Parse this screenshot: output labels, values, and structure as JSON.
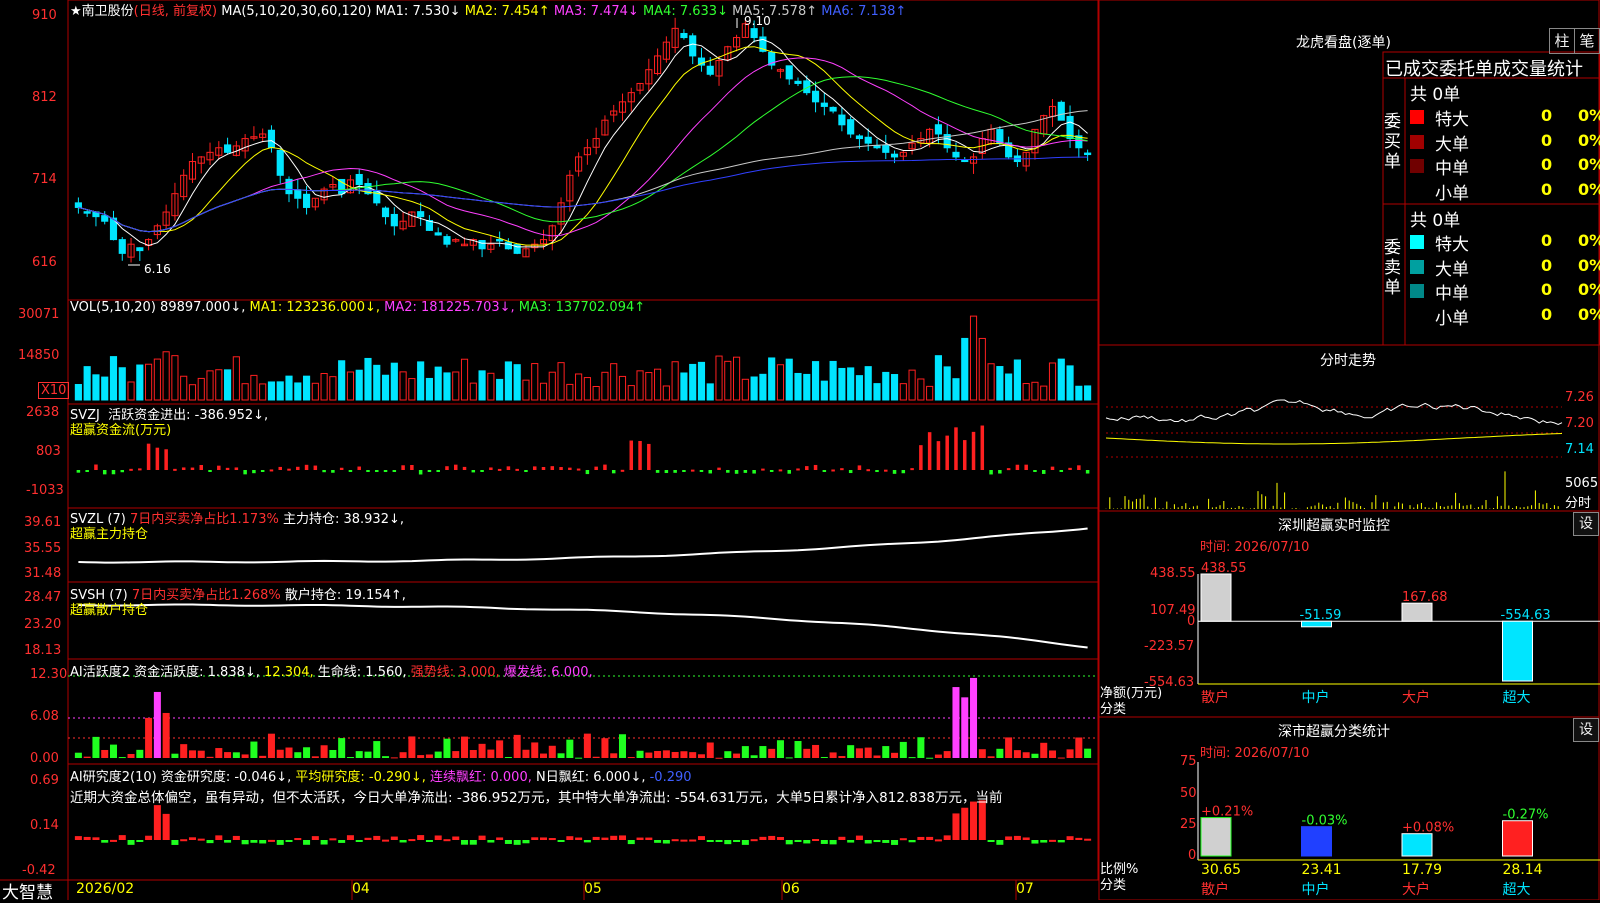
{
  "app": {
    "name": "大智慧"
  },
  "stock": {
    "name": "南卫股份",
    "period": "(日线, 前复权)"
  },
  "colors": {
    "up": "#ff2020",
    "down": "#00e5ff",
    "ma1": "#ffffff",
    "ma2": "#ffff00",
    "ma3": "#ff40ff",
    "ma4": "#30ff30",
    "ma5": "#c8c8c8",
    "ma6": "#3040ff"
  },
  "price_panel": {
    "ma_header": "MA(5,10,20,30,60,120)",
    "ma_items": [
      {
        "label": "MA1: 7.530↓",
        "color": "#ffffff"
      },
      {
        "label": "MA2: 7.454↑",
        "color": "#ffff00"
      },
      {
        "label": "MA3: 7.474↓",
        "color": "#ff40ff"
      },
      {
        "label": "MA4: 7.633↓",
        "color": "#30ff30"
      },
      {
        "label": "MA5: 7.578↑",
        "color": "#c8c8c8"
      },
      {
        "label": "MA6: 7.138↑",
        "color": "#4060ff"
      }
    ],
    "y_ticks": [
      "910",
      "812",
      "714",
      "616"
    ],
    "high_label": "9.10",
    "low_label": "6.16"
  },
  "vol_panel": {
    "header": "VOL(5,10,20)",
    "items": [
      {
        "label": "89897.000↓,",
        "color": "#ffffff"
      },
      {
        "label": "MA1: 123236.000↓,",
        "color": "#ffff00"
      },
      {
        "label": "MA2: 181225.703↓,",
        "color": "#ff40ff"
      },
      {
        "label": "MA3: 137702.094↑",
        "color": "#30ff30"
      }
    ],
    "y_ticks": [
      "30071",
      "14850"
    ],
    "unit": "X10"
  },
  "svzj_panel": {
    "header": "SVZJ",
    "item": "活跃资金进出: -386.952↓,",
    "subtitle": "超赢资金流(万元)",
    "y_ticks": [
      "2638",
      "803",
      "-1033"
    ]
  },
  "svzl_panel": {
    "header": "SVZL (7)",
    "pct": "7日内买卖净占比1.173%",
    "item": "主力持仓: 38.932↓,",
    "subtitle": "超赢主力持仓",
    "y_ticks": [
      "39.61",
      "35.55",
      "31.48"
    ]
  },
  "svsh_panel": {
    "header": "SVSH (7)",
    "pct": "7日内买卖净占比1.268%",
    "item": "散户持仓: 19.154↑,",
    "subtitle": "超赢散户持仓",
    "y_ticks": [
      "28.47",
      "23.20",
      "18.13"
    ]
  },
  "ai1_panel": {
    "header": "AI活跃度2",
    "items": [
      {
        "label": "资金活跃度: 1.838↓,",
        "color": "#ffffff"
      },
      {
        "label": "12.304,",
        "color": "#ffff00"
      },
      {
        "label": "生命线: 1.560,",
        "color": "#ffffff"
      },
      {
        "label": "强势线: 3.000,",
        "color": "#ff3030"
      },
      {
        "label": "爆发线: 6.000,",
        "color": "#ff40ff"
      }
    ],
    "y_ticks": [
      "12.30",
      "6.08",
      "0.00"
    ]
  },
  "ai2_panel": {
    "header": "AI研究度2(10)",
    "items": [
      {
        "label": "资金研究度: -0.046↓,",
        "color": "#ffffff"
      },
      {
        "label": "平均研究度: -0.290↓,",
        "color": "#ffff00"
      },
      {
        "label": "连续飘红: 0.000,",
        "color": "#ff40ff"
      },
      {
        "label": "N日飘红: 6.000↓,",
        "color": "#ffffff"
      },
      {
        "label": "-0.290",
        "color": "#4060ff"
      }
    ],
    "commentary": "近期大资金总体偏空，虽有异动，但不太活跃，今日大单净流出: -386.952万元，其中特大单净流出: -554.631万元，大单5日累计净入812.838万元，当前",
    "y_ticks": [
      "0.69",
      "0.14",
      "-0.42"
    ]
  },
  "x_axis": {
    "labels": [
      "2026/02",
      "04",
      "05",
      "06",
      "07"
    ]
  },
  "longhu": {
    "title": "龙虎看盘(逐单)",
    "tab_bar": "柱",
    "tab_pen": "笔",
    "section_title": "已成交委托单成交量统计",
    "buy_label": "委买单",
    "sell_label": "委卖单",
    "buy_total": "共 0单",
    "sell_total": "共 0单",
    "buy_rows": [
      {
        "name": "特大",
        "count": "0",
        "pct": "0%",
        "color": "#ff0000"
      },
      {
        "name": "大单",
        "count": "0",
        "pct": "0%",
        "color": "#a00000"
      },
      {
        "name": "中单",
        "count": "0",
        "pct": "0%",
        "color": "#700000"
      },
      {
        "name": "小单",
        "count": "0",
        "pct": "0%",
        "color": ""
      }
    ],
    "sell_rows": [
      {
        "name": "特大",
        "count": "0",
        "pct": "0%",
        "color": "#00ffff"
      },
      {
        "name": "大单",
        "count": "0",
        "pct": "0%",
        "color": "#00a0a0"
      },
      {
        "name": "中单",
        "count": "0",
        "pct": "0%",
        "color": "#008888"
      },
      {
        "name": "小单",
        "count": "0",
        "pct": "0%",
        "color": ""
      }
    ]
  },
  "intraday": {
    "title": "分时走势",
    "y_ticks": [
      "7.26",
      "7.20",
      "7.14"
    ],
    "vol_tick": "5065",
    "unit": "分时"
  },
  "monitor": {
    "title": "深圳超赢实时监控",
    "set": "设",
    "time": "时间: 2026/07/10",
    "y_ticks": [
      "438.55",
      "107.49",
      "0",
      "-223.57",
      "-554.63"
    ],
    "ylabel": "净额(万元)",
    "xlabel": "分类",
    "chart_data": {
      "type": "bar",
      "categories": [
        "散户",
        "中户",
        "大户",
        "超大"
      ],
      "values": [
        438.55,
        -51.59,
        167.68,
        -554.63
      ],
      "value_labels": [
        "438.55",
        "-51.59",
        "167.68",
        "-554.63"
      ],
      "ylabel": "净额(万元)",
      "xlabel": "分类",
      "ylim": [
        -554.63,
        438.55
      ]
    }
  },
  "classify": {
    "title": "深市超赢分类统计",
    "set": "设",
    "time": "时间: 2026/07/10",
    "y_ticks": [
      "75",
      "50",
      "25",
      "0"
    ],
    "ylabel": "比例%",
    "xlabel": "分类",
    "chart_data": {
      "type": "bar",
      "categories": [
        "散户",
        "中户",
        "大户",
        "超大"
      ],
      "values": [
        30.65,
        23.41,
        17.79,
        28.14
      ],
      "value_labels": [
        "30.65",
        "23.41",
        "17.79",
        "28.14"
      ],
      "change_labels": [
        "+0.21%",
        "-0.03%",
        "+0.08%",
        "-0.27%"
      ],
      "ylabel": "比例%",
      "xlabel": "分类",
      "ylim": [
        0,
        75
      ]
    }
  },
  "chart_data": [
    {
      "type": "candlestick",
      "title": "南卫股份 (日线, 前复权)",
      "ylim": [
        6.16,
        9.1
      ],
      "high": 9.1,
      "low": 6.16,
      "closes": [
        6.95,
        6.9,
        6.85,
        6.8,
        6.6,
        6.45,
        6.55,
        6.48,
        6.6,
        6.75,
        6.9,
        7.1,
        7.3,
        7.45,
        7.5,
        7.55,
        7.6,
        7.55,
        7.62,
        7.7,
        7.72,
        7.75,
        7.6,
        7.3,
        7.1,
        7.05,
        6.95,
        7.05,
        7.15,
        7.2,
        7.1,
        7.25,
        7.2,
        7.1,
        7.0,
        6.85,
        6.75,
        6.8,
        6.9,
        6.85,
        6.7,
        6.65,
        6.55,
        6.6,
        6.55,
        6.6,
        6.5,
        6.55,
        6.6,
        6.5,
        6.45,
        6.5,
        6.55,
        6.6,
        6.75,
        7.0,
        7.3,
        7.5,
        7.6,
        7.7,
        7.9,
        8.0,
        8.1,
        8.2,
        8.3,
        8.45,
        8.6,
        8.75,
        8.9,
        8.8,
        8.6,
        8.5,
        8.4,
        8.55,
        8.7,
        8.8,
        8.95,
        8.8,
        8.65,
        8.5,
        8.45,
        8.35,
        8.3,
        8.2,
        8.1,
        8.05,
        8.0,
        7.85,
        7.75,
        7.7,
        7.65,
        7.6,
        7.55,
        7.5,
        7.55,
        7.65,
        7.7,
        7.8,
        7.75,
        7.6,
        7.5,
        7.45,
        7.5,
        7.7,
        7.8,
        7.65,
        7.5,
        7.45,
        7.55,
        7.8,
        7.95,
        8.05,
        7.9,
        7.7,
        7.6,
        7.53
      ]
    }
  ]
}
